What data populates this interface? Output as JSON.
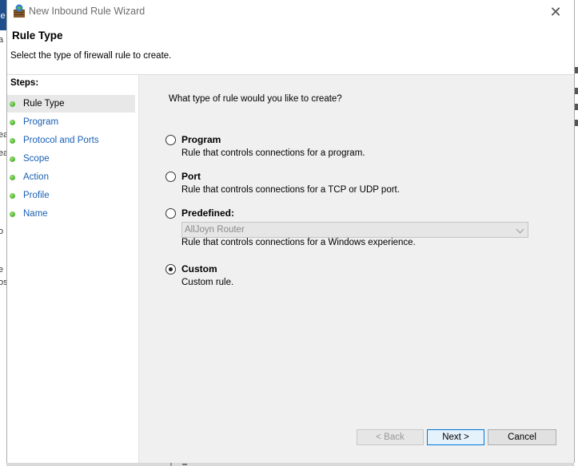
{
  "window": {
    "title": "New Inbound Rule Wizard",
    "close_symbol": "✕"
  },
  "header": {
    "title": "Rule Type",
    "subtitle": "Select the type of firewall rule to create."
  },
  "steps": {
    "heading": "Steps:",
    "items": [
      {
        "label": "Rule Type",
        "selected": true
      },
      {
        "label": "Program",
        "selected": false
      },
      {
        "label": "Protocol and Ports",
        "selected": false
      },
      {
        "label": "Scope",
        "selected": false
      },
      {
        "label": "Action",
        "selected": false
      },
      {
        "label": "Profile",
        "selected": false
      },
      {
        "label": "Name",
        "selected": false
      }
    ]
  },
  "main": {
    "question": "What type of rule would you like to create?",
    "options": [
      {
        "label": "Program",
        "description": "Rule that controls connections for a program.",
        "checked": false
      },
      {
        "label": "Port",
        "description": "Rule that controls connections for a TCP or UDP port.",
        "checked": false
      },
      {
        "label": "Predefined:",
        "description": "Rule that controls connections for a Windows experience.",
        "checked": false,
        "select_value": "AllJoyn Router"
      },
      {
        "label": "Custom",
        "description": "Custom rule.",
        "checked": true
      }
    ]
  },
  "buttons": {
    "back": "< Back",
    "next": "Next >",
    "cancel": "Cancel"
  },
  "background": {
    "left_fragments": [
      "le",
      "a",
      "ea",
      "ea",
      "o",
      "e",
      "os"
    ]
  },
  "colors": {
    "step_dot": "#2f9b12",
    "link": "#1a5fb4",
    "focus_border": "#0078d7"
  }
}
